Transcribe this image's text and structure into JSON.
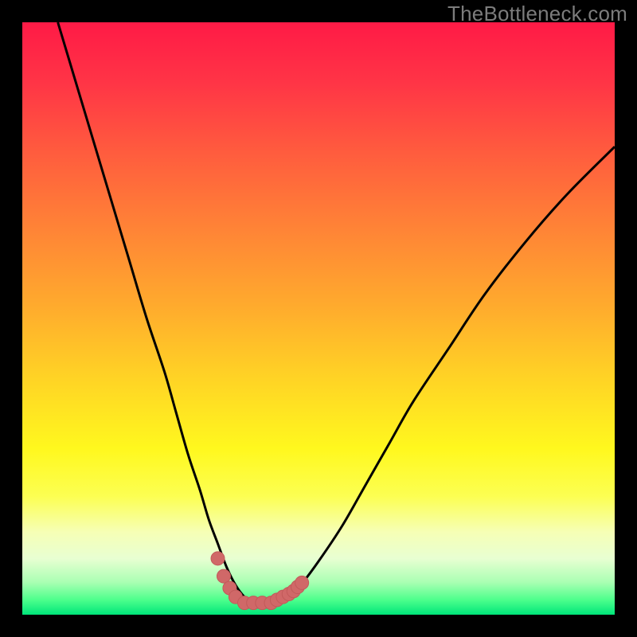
{
  "watermark": "TheBottleneck.com",
  "colors": {
    "frame": "#000000",
    "gradient_stops": [
      {
        "offset": 0.0,
        "color": "#ff1a46"
      },
      {
        "offset": 0.1,
        "color": "#ff3446"
      },
      {
        "offset": 0.22,
        "color": "#ff5c3e"
      },
      {
        "offset": 0.35,
        "color": "#ff8436"
      },
      {
        "offset": 0.48,
        "color": "#ffab2d"
      },
      {
        "offset": 0.6,
        "color": "#ffd325"
      },
      {
        "offset": 0.72,
        "color": "#fff81e"
      },
      {
        "offset": 0.8,
        "color": "#fcff52"
      },
      {
        "offset": 0.86,
        "color": "#f6ffb5"
      },
      {
        "offset": 0.905,
        "color": "#e8ffd2"
      },
      {
        "offset": 0.945,
        "color": "#aaffb3"
      },
      {
        "offset": 0.975,
        "color": "#4dff8c"
      },
      {
        "offset": 1.0,
        "color": "#00e57a"
      }
    ],
    "curve_stroke": "#000000",
    "marker_fill": "#d06868",
    "marker_stroke": "#c25a5a"
  },
  "chart_data": {
    "type": "line",
    "title": "",
    "xlabel": "",
    "ylabel": "",
    "xlim": [
      0,
      100
    ],
    "ylim": [
      0,
      100
    ],
    "series": [
      {
        "name": "bottleneck-curve",
        "x": [
          6,
          9,
          12,
          15,
          18,
          21,
          24,
          26,
          28,
          30,
          31.5,
          33,
          34.5,
          36,
          37.5,
          39,
          41,
          43,
          45,
          47,
          50,
          54,
          58,
          62,
          66,
          72,
          78,
          85,
          92,
          100
        ],
        "y": [
          100,
          90,
          80,
          70,
          60,
          50,
          41,
          34,
          27,
          21,
          16,
          12,
          8,
          5,
          3,
          2,
          2,
          2,
          3,
          5,
          9,
          15,
          22,
          29,
          36,
          45,
          54,
          63,
          71,
          79
        ]
      }
    ],
    "markers": {
      "name": "bottom-markers",
      "x": [
        33.0,
        34.0,
        35.0,
        36.0,
        37.5,
        39.0,
        40.5,
        42.0,
        43.0,
        44.0,
        45.0,
        45.8,
        46.5,
        47.2
      ],
      "y": [
        9.5,
        6.5,
        4.5,
        3.0,
        2.0,
        2.0,
        2.0,
        2.0,
        2.5,
        3.0,
        3.5,
        4.0,
        4.7,
        5.4
      ]
    }
  }
}
